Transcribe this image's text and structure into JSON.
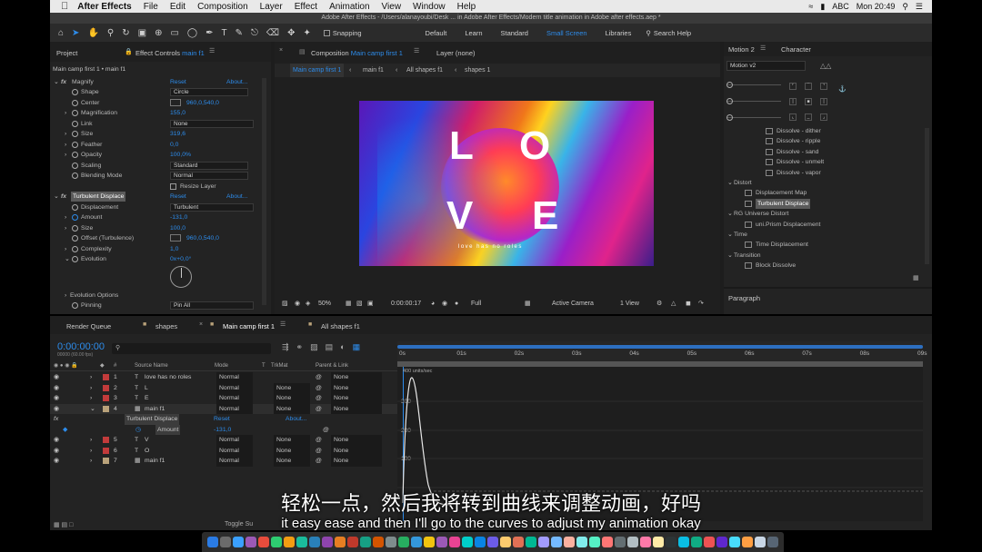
{
  "menubar": {
    "app": "After Effects",
    "items": [
      "File",
      "Edit",
      "Composition",
      "Layer",
      "Effect",
      "Animation",
      "View",
      "Window",
      "Help"
    ],
    "input_source": "ABC",
    "clock": "Mon 20:49"
  },
  "titlebar": "Adobe After Effects - /Users/alanayoubi/Desk ... in Adobe After Effects/Modern title animation in Adobe after effects.aep *",
  "toolbar": {
    "snapping": "Snapping",
    "workspaces": [
      "Default",
      "Learn",
      "Standard",
      "Small Screen",
      "Libraries"
    ],
    "active_workspace": "Small Screen",
    "search": "Search Help"
  },
  "project_panel": {
    "tab_project": "Project",
    "tab_effect_controls": "Effect Controls",
    "effect_controls_target": "main f1",
    "header": "Main camp first 1 • main f1",
    "magnify": {
      "name": "Magnify",
      "reset": "Reset",
      "about": "About...",
      "props": [
        {
          "label": "Shape",
          "value": "Circle"
        },
        {
          "label": "Center",
          "value": "960,0,540,0"
        },
        {
          "label": "Magnification",
          "value": "155,0"
        },
        {
          "label": "Link",
          "value": "None"
        },
        {
          "label": "Size",
          "value": "319,6"
        },
        {
          "label": "Feather",
          "value": "0,0"
        },
        {
          "label": "Opacity",
          "value": "100,0%"
        },
        {
          "label": "Scaling",
          "value": "Standard"
        },
        {
          "label": "Blending Mode",
          "value": "Normal"
        }
      ],
      "resize_layer": "Resize Layer"
    },
    "turbulent": {
      "name": "Turbulent Displace",
      "reset": "Reset",
      "about": "About...",
      "props": [
        {
          "label": "Displacement",
          "value": "Turbulent"
        },
        {
          "label": "Amount",
          "value": "-131,0"
        },
        {
          "label": "Size",
          "value": "100,0"
        },
        {
          "label": "Offset (Turbulence)",
          "value": "960,0,540,0"
        },
        {
          "label": "Complexity",
          "value": "1,0"
        },
        {
          "label": "Evolution",
          "value": "0x+0,0°"
        }
      ],
      "evolution_options": "Evolution Options",
      "pinning": {
        "label": "Pinning",
        "value": "Pin All"
      }
    }
  },
  "composition": {
    "tab": "Composition",
    "tab_name": "Main camp first 1",
    "layer_tab": "Layer (none)",
    "breadcrumbs": [
      "Main camp first 1",
      "main f1",
      "All shapes f1",
      "shapes 1"
    ],
    "letters": [
      "L",
      "O",
      "V",
      "E"
    ],
    "tagline": "love has no roles",
    "zoom": "50%",
    "timecode": "0:00:00:17",
    "resolution": "Full",
    "camera": "Active Camera",
    "views": "1 View"
  },
  "effects_panel": {
    "tab_motion": "Motion 2",
    "tab_character": "Character",
    "preset": "Motion v2",
    "items": [
      {
        "text": "Dissolve - dither",
        "kind": "item"
      },
      {
        "text": "Dissolve - ripple",
        "kind": "item"
      },
      {
        "text": "Dissolve - sand",
        "kind": "item"
      },
      {
        "text": "Dissolve - unmelt",
        "kind": "item"
      },
      {
        "text": "Dissolve - vapor",
        "kind": "item"
      },
      {
        "text": "Distort",
        "kind": "group"
      },
      {
        "text": "Displacement Map",
        "kind": "item"
      },
      {
        "text": "Turbulent Displace",
        "kind": "selected"
      },
      {
        "text": "RG Universe Distort",
        "kind": "group"
      },
      {
        "text": "uni.Prism Displacement",
        "kind": "item"
      },
      {
        "text": "Time",
        "kind": "group"
      },
      {
        "text": "Time Displacement",
        "kind": "item"
      },
      {
        "text": "Transition",
        "kind": "group"
      },
      {
        "text": "Block Dissolve",
        "kind": "item"
      }
    ],
    "paragraph": "Paragraph"
  },
  "timeline": {
    "tabs": [
      "Render Queue",
      "shapes",
      "Main camp first 1",
      "All shapes f1"
    ],
    "active_tab": "Main camp first 1",
    "timecode": "0:00:00:00",
    "fps": "00000 (60.00 fps)",
    "columns": {
      "source": "Source Name",
      "mode": "Mode",
      "t": "T",
      "trkmat": "TrkMat",
      "parent": "Parent & Link"
    },
    "layers": [
      {
        "num": "1",
        "type": "T",
        "name": "love has no roles",
        "mode": "Normal",
        "trkmat": "",
        "parent": "None",
        "color": "#c23b3b"
      },
      {
        "num": "2",
        "type": "T",
        "name": "L",
        "mode": "Normal",
        "trkmat": "None",
        "parent": "None",
        "color": "#c23b3b"
      },
      {
        "num": "3",
        "type": "T",
        "name": "E",
        "mode": "Normal",
        "trkmat": "None",
        "parent": "None",
        "color": "#c23b3b"
      },
      {
        "num": "4",
        "type": "img",
        "name": "main f1",
        "mode": "Normal",
        "trkmat": "None",
        "parent": "None",
        "color": "#b9a27a"
      },
      {
        "num": "5",
        "type": "T",
        "name": "V",
        "mode": "Normal",
        "trkmat": "None",
        "parent": "None",
        "color": "#c23b3b"
      },
      {
        "num": "6",
        "type": "T",
        "name": "O",
        "mode": "Normal",
        "trkmat": "None",
        "parent": "None",
        "color": "#c23b3b"
      },
      {
        "num": "7",
        "type": "img",
        "name": "main f1",
        "mode": "Normal",
        "trkmat": "None",
        "parent": "None",
        "color": "#b9a27a"
      }
    ],
    "effect_row": {
      "name": "Turbulent Displace",
      "reset": "Reset",
      "about": "About..."
    },
    "amount_row": {
      "label": "Amount",
      "value": "-131,0"
    },
    "ruler": [
      "0s",
      "01s",
      "02s",
      "03s",
      "04s",
      "05s",
      "06s",
      "07s",
      "08s",
      "09s"
    ],
    "graph_labels": [
      "300",
      "200",
      "100"
    ],
    "graph_header": "400 units/sec",
    "toggle": "Toggle Su"
  },
  "subtitles": {
    "cn": "轻松一点，然后我将转到曲线来调整动画，好吗",
    "en": "it easy ease and then I'll go to the curves to adjust my animation okay"
  },
  "colors": {
    "accent": "#2d8ceb",
    "panel_bg": "#232323",
    "label_red": "#c23b3b",
    "label_tan": "#b9a27a"
  }
}
